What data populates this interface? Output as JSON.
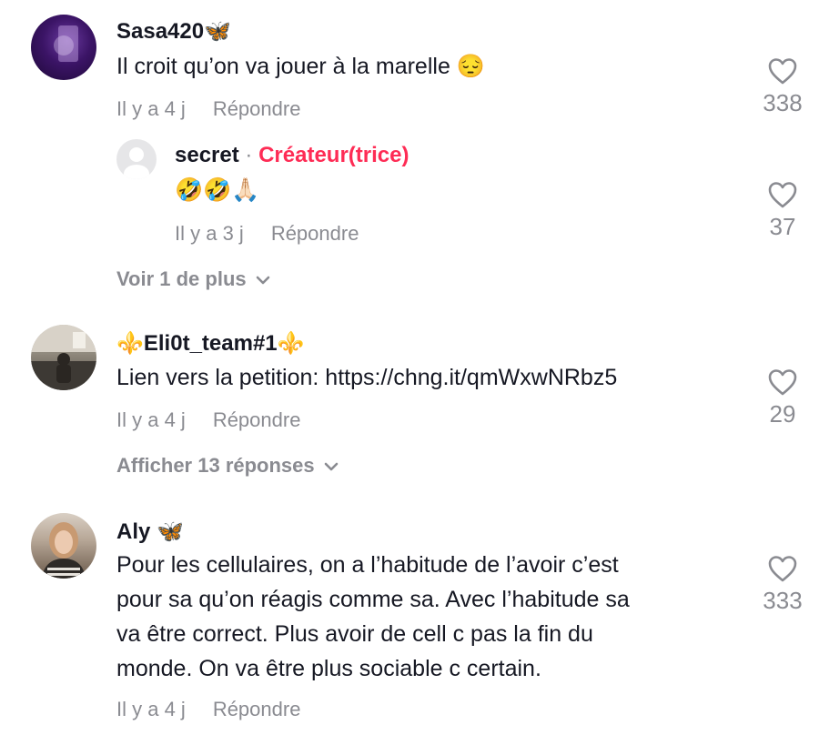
{
  "comments": [
    {
      "username": "Sasa420🦋",
      "text": "Il croit qu’on va jouer à la marelle 😔",
      "time": "Il y a 4 j",
      "reply_label": "Répondre",
      "likes": "338"
    },
    {
      "username": "secret",
      "separator": "·",
      "badge": "Créateur(trice)",
      "text": "🤣🤣🙏🏻",
      "time": "Il y a 3 j",
      "reply_label": "Répondre",
      "likes": "37"
    },
    {
      "username": "⚜️Eli0t_team#1⚜️",
      "text": "Lien vers la petition: https://chng.it/qmWxwNRbz5",
      "time": "Il y a 4 j",
      "reply_label": "Répondre",
      "likes": "29"
    },
    {
      "username": "Aly 🦋",
      "text_lines": [
        "Pour les cellulaires, on a l’habitude de l’avoir c’est",
        "pour sa qu’on réagis comme sa. Avec l’habitude sa",
        "va être correct. Plus avoir de cell c pas la fin du",
        "monde. On va être plus sociable c certain."
      ],
      "time": "Il y a 4 j",
      "reply_label": "Répondre",
      "likes": "333"
    }
  ],
  "more_replies": [
    {
      "label": "Voir 1 de plus"
    },
    {
      "label": "Afficher 13 réponses"
    }
  ],
  "icons": [
    "heart-icon",
    "chevron-down-icon",
    "default-avatar-icon"
  ],
  "colors": {
    "creator_badge": "#fe2c55",
    "muted_text": "#8a8b91",
    "text": "#161823"
  }
}
